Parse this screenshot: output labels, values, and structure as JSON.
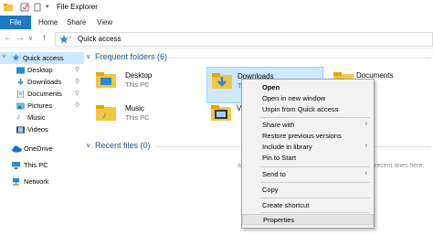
{
  "window": {
    "title": "File Explorer"
  },
  "ribbon": {
    "tabs": [
      "File",
      "Home",
      "Share",
      "View"
    ]
  },
  "address": {
    "path": "Quick access"
  },
  "nav": {
    "items": [
      {
        "label": "Quick access",
        "icon": "star-icon"
      },
      {
        "label": "Desktop",
        "icon": "desktop-icon"
      },
      {
        "label": "Downloads",
        "icon": "download-icon"
      },
      {
        "label": "Documents",
        "icon": "documents-icon"
      },
      {
        "label": "Pictures",
        "icon": "pictures-icon"
      },
      {
        "label": "Music",
        "icon": "music-icon"
      },
      {
        "label": "Videos",
        "icon": "videos-icon"
      },
      {
        "label": "OneDrive",
        "icon": "cloud-icon"
      },
      {
        "label": "This PC",
        "icon": "computer-icon"
      },
      {
        "label": "Network",
        "icon": "network-icon"
      }
    ]
  },
  "main": {
    "frequent_header": "Frequent folders (6)",
    "recent_header": "Recent files (0)",
    "recent_empty_partial": "recent ones here.",
    "folders": [
      {
        "name": "Desktop",
        "sub": "This PC"
      },
      {
        "name": "Downloads",
        "sub": "Th"
      },
      {
        "name": "Documents",
        "sub": ""
      },
      {
        "name": "Music",
        "sub": "This PC"
      },
      {
        "name": "Vi",
        "sub": ""
      }
    ]
  },
  "context_menu": {
    "items": [
      "Open",
      "Open in new window",
      "Unpin from Quick access",
      "Share with",
      "Restore previous versions",
      "Include in library",
      "Pin to Start",
      "Send to",
      "Copy",
      "Create shortcut",
      "Properties"
    ]
  },
  "colors": {
    "accent": "#1979ca",
    "selected": "#cce8ff",
    "folder": "#f4c542",
    "header": "#1e4e8c"
  }
}
